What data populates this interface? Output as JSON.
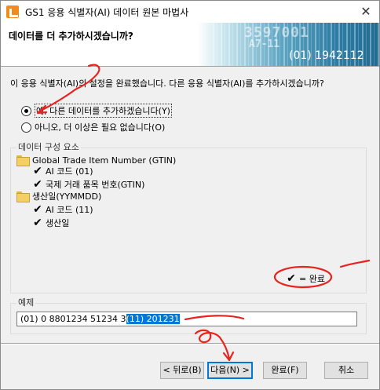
{
  "window": {
    "title": "GS1 응용 식별자(AI) 데이터 원본 마법사",
    "close_glyph": "✕"
  },
  "header": {
    "heading": "데이터를 더 추가하시겠습니까?",
    "banner_digits": "3597001",
    "banner_sub": "A7-11",
    "banner_gtin": "(01) 1942112"
  },
  "question": "이 응용 식별자(AI)의 설정을 완료했습니다. 다른 응용 식별자(AI)를 추가하시겠습니까?",
  "options": [
    {
      "label": "예, 다른 데이터를 추가하겠습니다(Y)",
      "checked": true
    },
    {
      "label": "아니오, 더 이상은 필요 없습니다(O)",
      "checked": false
    }
  ],
  "components": {
    "group_title": "데이터 구성 요소",
    "tree": [
      {
        "type": "folder",
        "label": "Global Trade Item Number (GTIN)"
      },
      {
        "type": "check",
        "label": "AI 코드 (01)"
      },
      {
        "type": "check",
        "label": "국제 거래 품목 번호(GTIN)"
      },
      {
        "type": "folder",
        "label": "생산일(YYMMDD)"
      },
      {
        "type": "check",
        "label": "AI 코드 (11)"
      },
      {
        "type": "check",
        "label": "생산일"
      }
    ],
    "legend": "= 완료",
    "check_glyph": "✔"
  },
  "example": {
    "group_title": "예제",
    "value_plain": "(01) 0 8801234 51234 3",
    "value_selected": "(11) 201231"
  },
  "buttons": {
    "back": "< 뒤로(B)",
    "next": "다음(N) >",
    "finish": "완료(F)",
    "cancel": "취소"
  },
  "colors": {
    "annotation": "#e8221c",
    "selection": "#0078d7",
    "default_button_border": "#0078d7"
  }
}
